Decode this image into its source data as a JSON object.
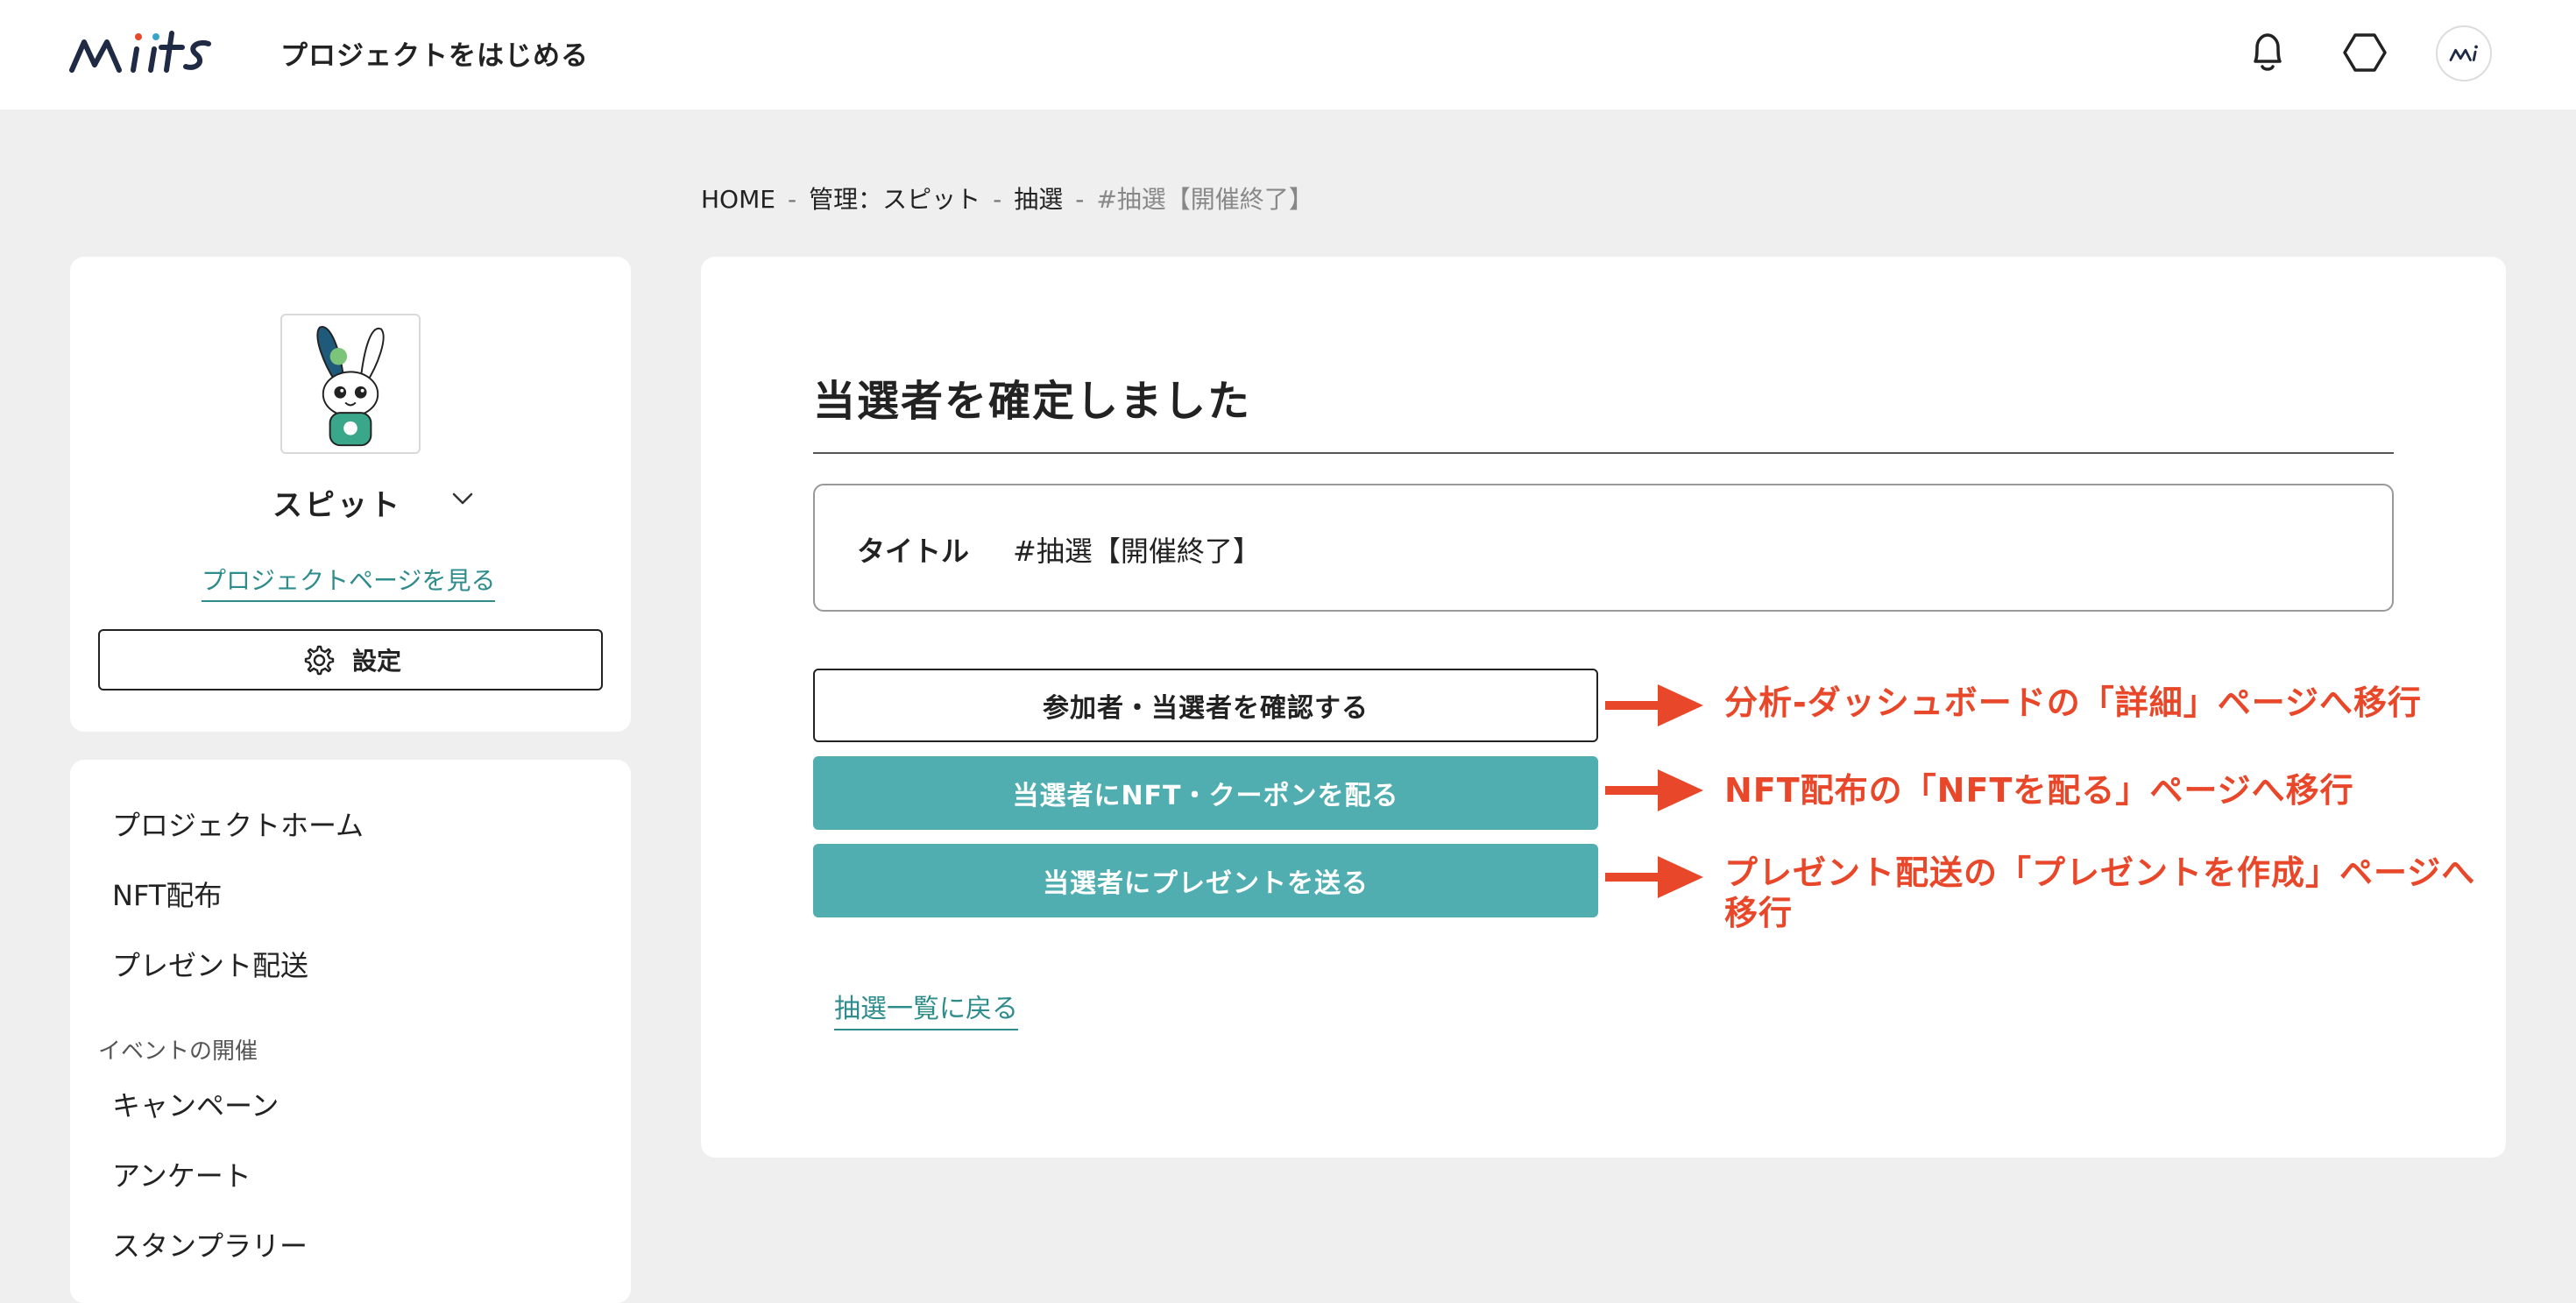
{
  "header": {
    "start_project_label": "プロジェクトをはじめる",
    "logo_text": "mits",
    "avatar_text": "mi"
  },
  "breadcrumb": [
    "HOME",
    "管理：スピット",
    "抽選",
    "#抽選【開催終了】"
  ],
  "breadcrumb_separator": "-",
  "sidebar": {
    "project_name": "スピット",
    "project_page_link": "プロジェクトページを見る",
    "settings_label": "設定",
    "nav_items": [
      "プロジェクトホーム",
      "NFT配布",
      "プレゼント配送"
    ],
    "event_group_label": "イベントの開催",
    "event_items": [
      "キャンペーン",
      "アンケート",
      "スタンプラリー"
    ]
  },
  "main": {
    "title": "当選者を確定しました",
    "info_label": "タイトル",
    "info_value": "#抽選【開催終了】",
    "buttons": [
      "参加者・当選者を確認する",
      "当選者にNFT・クーポンを配る",
      "当選者にプレゼントを送る"
    ],
    "back_link": "抽選一覧に戻る"
  },
  "annotations": [
    "分析-ダッシュボードの「詳細」ページへ移行",
    "NFT配布の「NFTを配る」ページへ移行",
    "プレゼント配送の「プレゼントを作成」ページへ",
    "移行"
  ],
  "colors": {
    "accent_teal": "#50aeb0",
    "link_teal": "#2f8c8c",
    "annotation_red": "#e8472a",
    "background": "#efefef"
  }
}
